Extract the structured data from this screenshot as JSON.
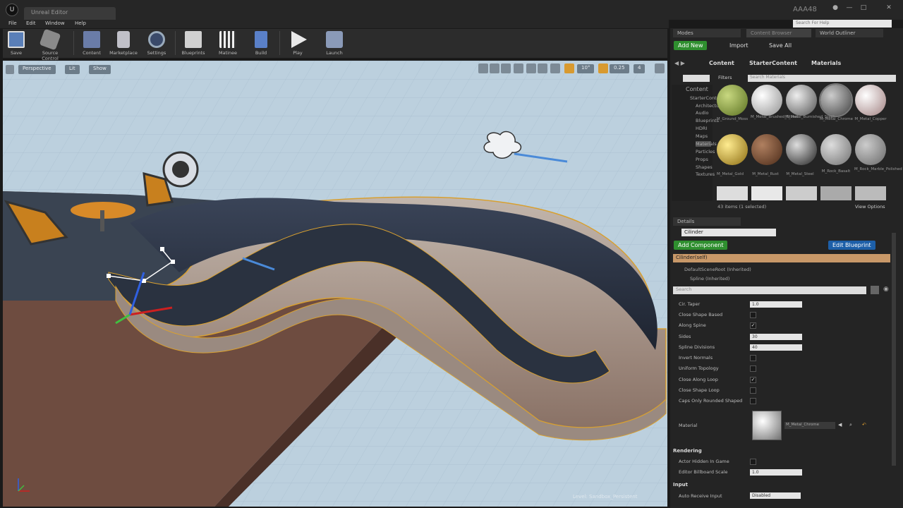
{
  "window": {
    "tab_title": "Unreal Editor",
    "project": "AAA48",
    "help_placeholder": "Search For Help"
  },
  "menu": [
    "File",
    "Edit",
    "Window",
    "Help"
  ],
  "toolbar": [
    {
      "label": "Save",
      "icon": "save-icon"
    },
    {
      "label": "Source Control",
      "icon": "source-control-icon"
    },
    {
      "label": "Content",
      "icon": "content-icon"
    },
    {
      "label": "Marketplace",
      "icon": "marketplace-icon"
    },
    {
      "label": "Settings",
      "icon": "settings-icon"
    },
    {
      "label": "Blueprints",
      "icon": "blueprints-icon"
    },
    {
      "label": "Matinee",
      "icon": "matinee-icon"
    },
    {
      "label": "Build",
      "icon": "build-icon"
    },
    {
      "label": "Play",
      "icon": "play-icon"
    },
    {
      "label": "Launch",
      "icon": "launch-icon"
    }
  ],
  "viewport": {
    "perspective": "Perspective",
    "lit": "Lit",
    "show": "Show",
    "snap_angle": "10°",
    "snap_scale": "0.25",
    "camera_speed": "4",
    "watermark": "Level: Sandbox_Persistent"
  },
  "panel_tabs": {
    "modes": "Modes",
    "content_browser": "Content Browser",
    "world_outliner": "World Outliner"
  },
  "content": {
    "add_new": "Add New",
    "import": "Import",
    "save_all": "Save All",
    "breadcrumb": [
      "Content",
      "StarterContent",
      "Materials"
    ],
    "filters": "Filters",
    "search_placeholder": "Search Materials",
    "tree": [
      "Content",
      "StarterContent",
      "Architecture",
      "Audio",
      "Blueprints",
      "HDRI",
      "Maps",
      "Materials",
      "Particles",
      "Props",
      "Shapes",
      "Textures"
    ],
    "assets": [
      {
        "label": "M_Ground_Moss",
        "color": "#8aa040"
      },
      {
        "label": "M_Metal_Brushed_Nickel",
        "color": "#d8d8d8"
      },
      {
        "label": "M_Metal_Burnished_Steel",
        "color": "#a8a8a8"
      },
      {
        "label": "M_Metal_Chrome",
        "color": "#8c8c8c"
      },
      {
        "label": "M_Metal_Copper",
        "color": "#d8b8b8"
      },
      {
        "label": "M_Metal_Gold",
        "color": "#c8a020"
      },
      {
        "label": "M_Metal_Rust",
        "color": "#7a5030"
      },
      {
        "label": "M_Metal_Steel",
        "color": "#606060"
      },
      {
        "label": "M_Rock_Basalt",
        "color": "#9a9a9a"
      },
      {
        "label": "M_Rock_Marble_Polished",
        "color": "#b0b0b0"
      }
    ],
    "count": "43 items (1 selected)",
    "view_options": "View Options"
  },
  "details": {
    "tab": "Details",
    "name": "Cilinder",
    "add_component": "Add Component",
    "edit_blueprint": "Edit Blueprint",
    "self": "Cilinder(self)",
    "root": "DefaultSceneRoot (Inherited)",
    "spline": "Spline (Inherited)",
    "search_placeholder": "Search",
    "props": [
      {
        "label": "Cir. Taper",
        "type": "num",
        "value": "1.0"
      },
      {
        "label": "Close Shape Based",
        "type": "chk",
        "checked": false
      },
      {
        "label": "Along Spine",
        "type": "chk",
        "checked": true
      },
      {
        "label": "Sides",
        "type": "num",
        "value": "30"
      },
      {
        "label": "Spline Divisions",
        "type": "num",
        "value": "40"
      },
      {
        "label": "Invert Normals",
        "type": "chk",
        "checked": false
      },
      {
        "label": "Uniform Topology",
        "type": "chk",
        "checked": false
      },
      {
        "label": "Close Along Loop",
        "type": "chk",
        "checked": true
      },
      {
        "label": "Close Shape Loop",
        "type": "chk",
        "checked": false
      },
      {
        "label": "Caps Only Rounded Shaped",
        "type": "chk",
        "checked": false
      }
    ],
    "material_label": "Material",
    "material_value": "M_Metal_Chrome",
    "rendering": "Rendering",
    "actor_hidden": "Actor Hidden In Game",
    "billboard_label": "Editor Billboard Scale",
    "billboard_value": "1.0",
    "input": "Input",
    "auto_receive": "Auto Receive Input",
    "auto_receive_value": "Disabled"
  }
}
